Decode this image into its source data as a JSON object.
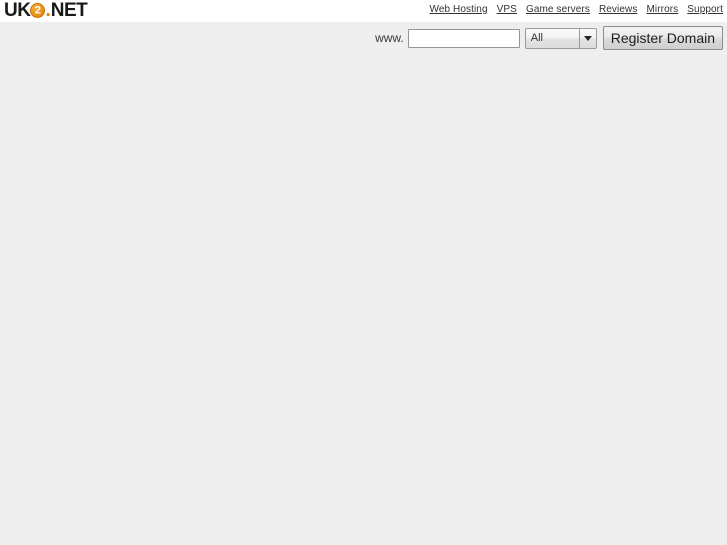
{
  "page": {
    "background_color": "#eeeeee",
    "header_background_color": "#ffffff"
  },
  "logo": {
    "name": "uk2net-logo",
    "prefix": "UK",
    "mark_digit": "2",
    "dot": ".",
    "suffix": "NET",
    "accent_color": "#e07c08",
    "text_color": "#1a1a1a"
  },
  "top_nav": {
    "items": [
      {
        "label": "Web Hosting",
        "name": "nav-web-hosting"
      },
      {
        "label": "VPS",
        "name": "nav-vps"
      },
      {
        "label": "Game servers",
        "name": "nav-game-servers"
      },
      {
        "label": "Reviews",
        "name": "nav-reviews"
      },
      {
        "label": "Mirrors",
        "name": "nav-mirrors"
      },
      {
        "label": "Support",
        "name": "nav-support"
      }
    ]
  },
  "domain_search": {
    "prefix_label": "www.",
    "input_value": "",
    "input_placeholder": "",
    "tld_selected": "All",
    "tld_options": [
      "All"
    ],
    "submit_label": "Register Domain"
  }
}
